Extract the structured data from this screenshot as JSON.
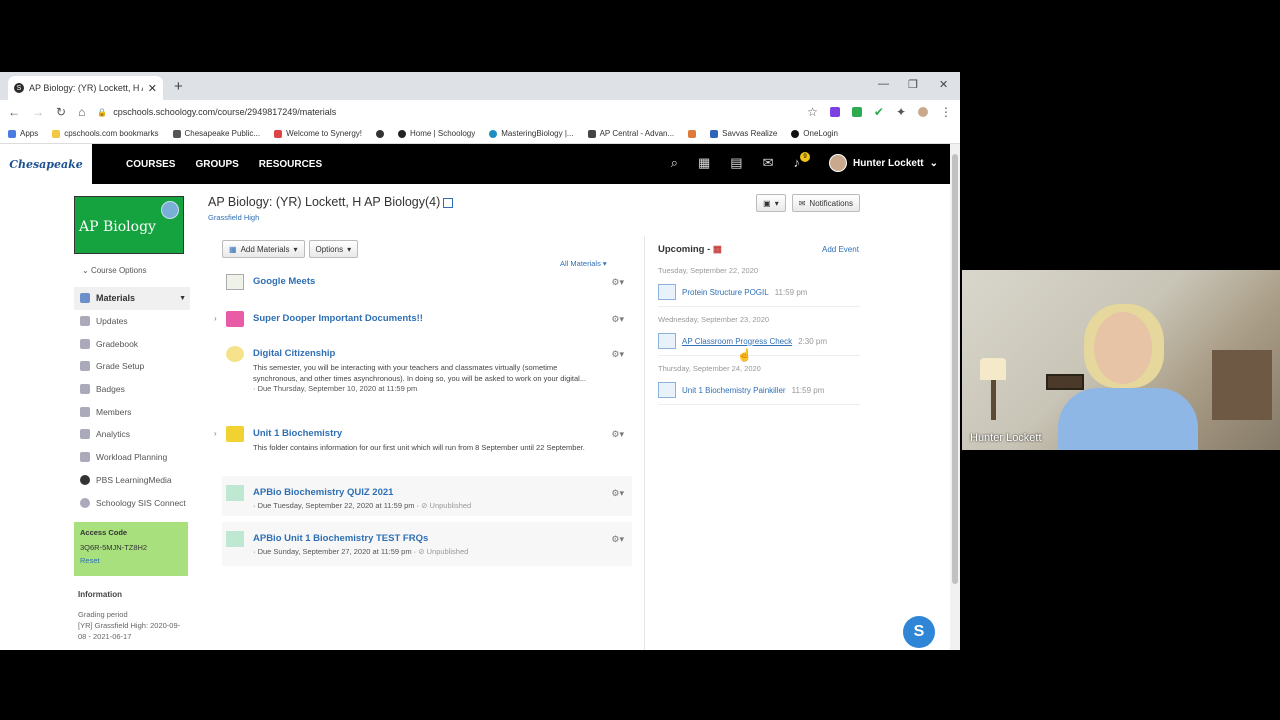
{
  "browser": {
    "tab_title": "AP Biology: (YR) Lockett, H AP Bi",
    "url": "cpschools.schoology.com/course/2949817249/materials",
    "bookmarks": [
      "Apps",
      "cpschools.com bookmarks",
      "Chesapeake Public...",
      "Welcome to Synergy!",
      "",
      "Home | Schoology",
      "MasteringBiology |...",
      "AP Central - Advan...",
      "",
      "Savvas Realize",
      "OneLogin"
    ]
  },
  "header": {
    "logo_text": "Chesapeake",
    "nav": [
      "COURSES",
      "GROUPS",
      "RESOURCES"
    ],
    "notif_count": "9",
    "user_name": "Hunter Lockett"
  },
  "left": {
    "course_pic_text": "AP Biology",
    "course_options": "Course Options",
    "menu": [
      "Materials",
      "Updates",
      "Gradebook",
      "Grade Setup",
      "Badges",
      "Members",
      "Analytics",
      "Workload Planning",
      "PBS LearningMedia",
      "Schoology SIS Connect"
    ],
    "access_code_label": "Access Code",
    "access_code": "3Q6R-5MJN-TZ8H2",
    "reset": "Reset",
    "info_heading": "Information",
    "grading_period_label": "Grading period",
    "grading_period": "[YR] Grassfield High: 2020-09-08 - 2021-06-17"
  },
  "main": {
    "title": "AP Biology: (YR) Lockett, H AP Biology(4)",
    "school": "Grassfield High",
    "add_materials": "Add Materials",
    "options": "Options",
    "all_materials": "All Materials",
    "notifications": "Notifications",
    "items": [
      {
        "title": "Google Meets"
      },
      {
        "title": "Super Dooper Important Documents!!"
      },
      {
        "title": "Digital Citizenship",
        "desc": "This semester, you will be interacting with your teachers and classmates virtually (sometime synchronous, and other times asynchronous). In doing so, you will be asked to work on your digital...",
        "due": "· Due Thursday, September 10, 2020 at 11:59 pm"
      },
      {
        "title": "Unit 1 Biochemistry",
        "desc": "This folder contains information for our first unit which will run from 8 September until 22 September."
      },
      {
        "title": "APBio Biochemistry QUIZ 2021",
        "due": "· Due Tuesday, September 22, 2020 at 11:59 pm · ",
        "status": "⊘ Unpublished"
      },
      {
        "title": "APBio Unit 1 Biochemistry TEST FRQs",
        "due": "· Due Sunday, September 27, 2020 at 11:59 pm · ",
        "status": "⊘ Unpublished"
      }
    ]
  },
  "upcoming": {
    "heading": "Upcoming -",
    "add_event": "Add Event",
    "days": [
      {
        "date": "Tuesday, September 22, 2020",
        "title": "Protein Structure POGIL",
        "time": "11:59 pm"
      },
      {
        "date": "Wednesday, September 23, 2020",
        "title": "AP Classroom Progress Check",
        "time": "2:30 pm"
      },
      {
        "date": "Thursday, September 24, 2020",
        "title": "Unit 1 Biochemistry Painkiller",
        "time": "11:59 pm"
      }
    ]
  },
  "webcam": {
    "name": "Hunter Lockett"
  },
  "colors": {
    "link": "#2f6fb5",
    "course_green": "#14a33f",
    "access_green": "#a8e07e",
    "help_button": "#2f86d6"
  }
}
